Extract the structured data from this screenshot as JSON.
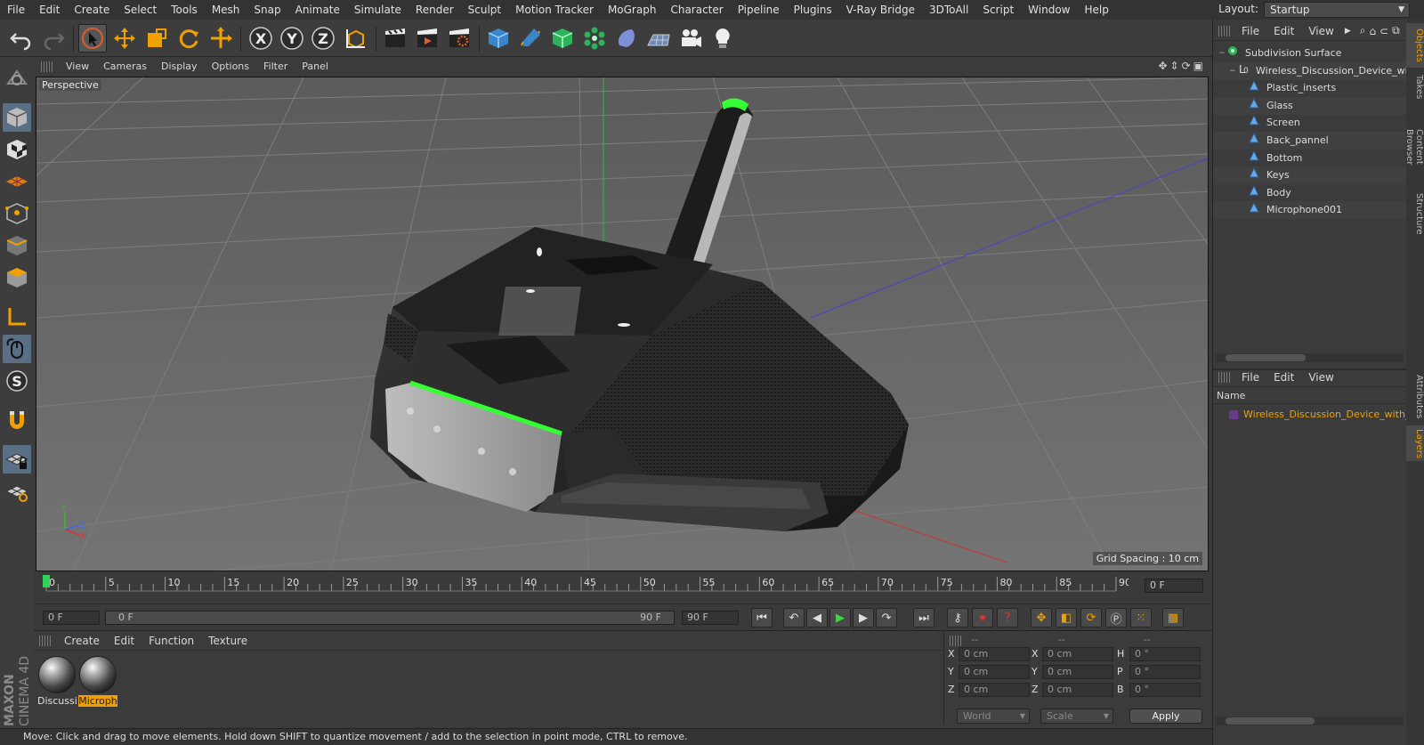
{
  "menubar": {
    "items": [
      "File",
      "Edit",
      "Create",
      "Select",
      "Tools",
      "Mesh",
      "Snap",
      "Animate",
      "Simulate",
      "Render",
      "Sculpt",
      "Motion Tracker",
      "MoGraph",
      "Character",
      "Pipeline",
      "Plugins",
      "V-Ray Bridge",
      "3DToAll",
      "Script",
      "Window",
      "Help"
    ],
    "layout_label": "Layout:",
    "layout_value": "Startup"
  },
  "toolbar": {
    "axis_x": "X",
    "axis_y": "Y",
    "axis_z": "Z"
  },
  "viewport": {
    "menu": [
      "View",
      "Cameras",
      "Display",
      "Options",
      "Filter",
      "Panel"
    ],
    "label": "Perspective",
    "grid_spacing": "Grid Spacing : 10 cm",
    "axis_y": "Y",
    "axis_z": "Z",
    "axis_x": "X"
  },
  "timeline": {
    "ticks": [
      "0",
      "5",
      "10",
      "15",
      "20",
      "25",
      "30",
      "35",
      "40",
      "45",
      "50",
      "55",
      "60",
      "65",
      "70",
      "75",
      "80",
      "85",
      "90"
    ],
    "current_frame": "0 F",
    "current_position": 0,
    "max_frame": 90
  },
  "transport": {
    "start_field": "0 F",
    "range_start": "0 F",
    "range_end": "90 F",
    "end_field": "90 F"
  },
  "materials": {
    "menu": [
      "Create",
      "Edit",
      "Function",
      "Texture"
    ],
    "items": [
      {
        "label": "Discussi",
        "selected": false
      },
      {
        "label": "Microph",
        "selected": true
      }
    ]
  },
  "coordinates": {
    "header": [
      "--",
      "--",
      "--"
    ],
    "rows": [
      {
        "l1": "X",
        "v1": "0 cm",
        "l2": "X",
        "v2": "0 cm",
        "l3": "H",
        "v3": "0 °"
      },
      {
        "l1": "Y",
        "v1": "0 cm",
        "l2": "Y",
        "v2": "0 cm",
        "l3": "P",
        "v3": "0 °"
      },
      {
        "l1": "Z",
        "v1": "0 cm",
        "l2": "Z",
        "v2": "0 cm",
        "l3": "B",
        "v3": "0 °"
      }
    ],
    "world": "World",
    "scale": "Scale",
    "apply": "Apply"
  },
  "status": "Move: Click and drag to move elements. Hold down SHIFT to quantize movement / add to the selection in point mode, CTRL to remove.",
  "objects": {
    "menu": [
      "File",
      "Edit",
      "View"
    ],
    "tree": [
      {
        "name": "Subdivision Surface",
        "depth": 0,
        "type": "subdiv"
      },
      {
        "name": "Wireless_Discussion_Device_with",
        "depth": 1,
        "type": "null"
      },
      {
        "name": "Plastic_inserts",
        "depth": 2,
        "type": "poly"
      },
      {
        "name": "Glass",
        "depth": 2,
        "type": "poly"
      },
      {
        "name": "Screen",
        "depth": 2,
        "type": "poly"
      },
      {
        "name": "Back_pannel",
        "depth": 2,
        "type": "poly"
      },
      {
        "name": "Bottom",
        "depth": 2,
        "type": "poly"
      },
      {
        "name": "Keys",
        "depth": 2,
        "type": "poly"
      },
      {
        "name": "Body",
        "depth": 2,
        "type": "poly"
      },
      {
        "name": "Microphone001",
        "depth": 2,
        "type": "poly"
      }
    ]
  },
  "layers": {
    "menu": [
      "File",
      "Edit",
      "View"
    ],
    "column": "Name",
    "item": "Wireless_Discussion_Device_with_"
  },
  "right_tabs": [
    "Objects",
    "Takes",
    "Content Browser",
    "Structure",
    "Attributes",
    "Layers"
  ],
  "brand": {
    "maxon": "MAXON",
    "cinema": "CINEMA 4D"
  },
  "colors": {
    "accent": "#f0a000",
    "selection": "#5a6f86",
    "green_light": "#33ff33"
  }
}
